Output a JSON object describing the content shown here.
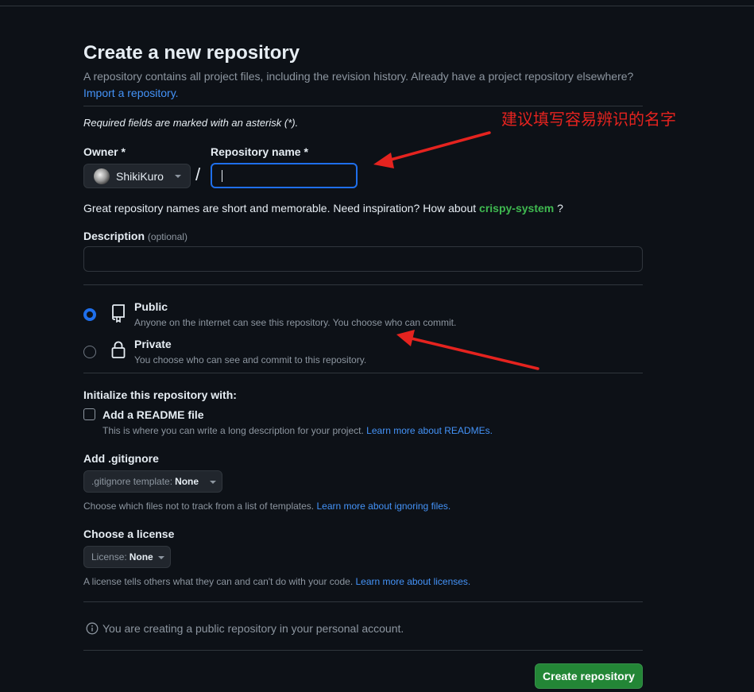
{
  "header": {
    "title": "Create a new repository",
    "subtitle": "A repository contains all project files, including the revision history. Already have a project repository elsewhere?",
    "import_link": "Import a repository."
  },
  "form": {
    "required_note": "Required fields are marked with an asterisk (*).",
    "owner_label": "Owner *",
    "owner_value": "ShikiKuro",
    "slash": "/",
    "repo_name_label": "Repository name *",
    "repo_name_value": "",
    "hint_prefix": "Great repository names are short and memorable. Need inspiration? How about",
    "hint_suggestion": "crispy-system",
    "hint_suffix": "?",
    "description_label": "Description",
    "description_optional": "(optional)",
    "description_value": ""
  },
  "visibility": {
    "selected": "Public",
    "options": [
      {
        "title": "Public",
        "desc": "Anyone on the internet can see this repository. You choose who can commit."
      },
      {
        "title": "Private",
        "desc": "You choose who can see and commit to this repository."
      }
    ]
  },
  "initialize": {
    "heading": "Initialize this repository with:",
    "readme_label": "Add a README file",
    "readme_checked": false,
    "readme_desc": "This is where you can write a long description for your project.",
    "readme_link": "Learn more about READMEs."
  },
  "gitignore": {
    "heading": "Add .gitignore",
    "select_prefix": ".gitignore template:",
    "select_value": "None",
    "help": "Choose which files not to track from a list of templates.",
    "help_link": "Learn more about ignoring files."
  },
  "license": {
    "heading": "Choose a license",
    "select_prefix": "License:",
    "select_value": "None",
    "help": "A license tells others what they can and can't do with your code.",
    "help_link": "Learn more about licenses."
  },
  "footer": {
    "info": "You are creating a public repository in your personal account.",
    "create_button": "Create repository"
  },
  "annotation": {
    "text": "建议填写容易辨识的名字",
    "color": "#e5231f"
  },
  "colors": {
    "accent": "#1f6feb",
    "link": "#4493f8",
    "success": "#238636",
    "suggest": "#3fb950"
  },
  "icons": {
    "public": "repo-icon",
    "private": "lock-icon",
    "info": "info-icon",
    "caret": "triangle-down-icon"
  }
}
